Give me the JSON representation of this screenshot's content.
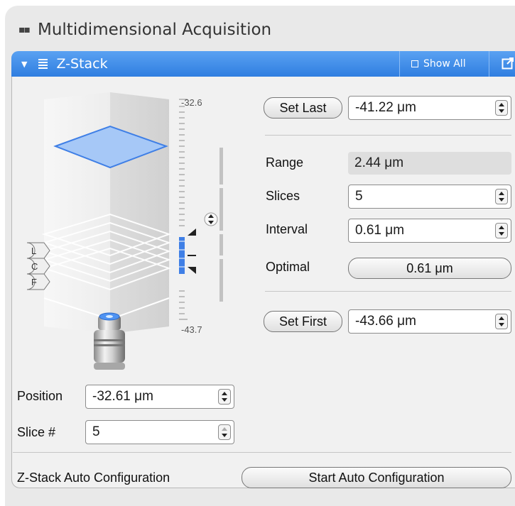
{
  "header": {
    "title": "Multidimensional Acquisition"
  },
  "zstack": {
    "title": "Z-Stack",
    "show_all": "Show All",
    "scale_top": "-32.6",
    "scale_bottom": "-43.7",
    "markers": [
      "L",
      "C",
      "F"
    ],
    "set_last": {
      "label": "Set Last",
      "value": "-41.22 μm"
    },
    "range": {
      "label": "Range",
      "value": "2.44 μm"
    },
    "slices": {
      "label": "Slices",
      "value": "5"
    },
    "interval": {
      "label": "Interval",
      "value": "0.61 μm"
    },
    "optimal": {
      "label": "Optimal",
      "value": "0.61 μm"
    },
    "set_first": {
      "label": "Set First",
      "value": "-43.66 μm"
    },
    "position": {
      "label": "Position",
      "value": "-32.61 μm"
    },
    "slice_num": {
      "label": "Slice #",
      "value": "5"
    },
    "auto_config": {
      "label": "Z-Stack Auto Configuration",
      "button": "Start Auto Configuration"
    }
  },
  "colors": {
    "accent": "#2f7ee0",
    "panel": "#f1f1f1",
    "stack_blue": "#3f7fe6"
  }
}
